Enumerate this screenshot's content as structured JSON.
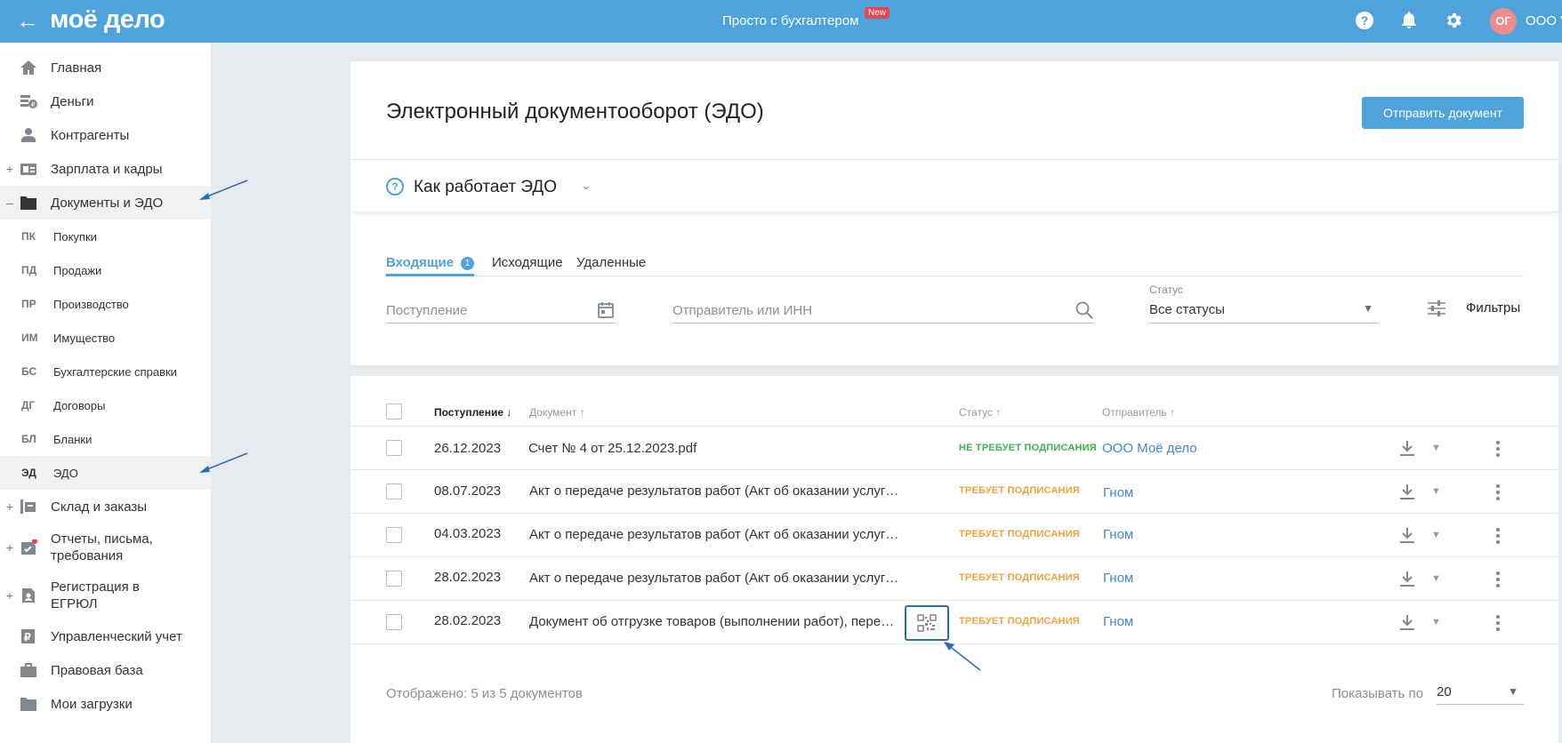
{
  "header": {
    "logo": "моё дело",
    "title": "Просто с бухгалтером",
    "new_badge": "New",
    "avatar_initials": "ОГ",
    "org_name": "ООО \""
  },
  "sidebar": {
    "items": [
      {
        "label": "Главная",
        "icon": "home-icon"
      },
      {
        "label": "Деньги",
        "icon": "money-icon"
      },
      {
        "label": "Контрагенты",
        "icon": "contractors-icon"
      },
      {
        "label": "Зарплата и кадры",
        "icon": "salary-icon",
        "expand": "+"
      },
      {
        "label": "Документы и ЭДО",
        "icon": "folder-icon",
        "expand": "–"
      },
      {
        "label": "Склад и заказы",
        "icon": "warehouse-icon",
        "expand": "+"
      },
      {
        "label": "Отчеты, письма, требования",
        "icon": "reports-icon",
        "expand": "+"
      },
      {
        "label": "Регистрация в ЕГРЮЛ",
        "icon": "registration-icon",
        "expand": "+"
      },
      {
        "label": "Управленческий учет",
        "icon": "ruble-icon"
      },
      {
        "label": "Правовая база",
        "icon": "briefcase-icon"
      },
      {
        "label": "Мои загрузки",
        "icon": "downloads-folder-icon"
      }
    ],
    "subitems": [
      {
        "abbr": "ПК",
        "label": "Покупки"
      },
      {
        "abbr": "ПД",
        "label": "Продажи"
      },
      {
        "abbr": "ПР",
        "label": "Производство"
      },
      {
        "abbr": "ИМ",
        "label": "Имущество"
      },
      {
        "abbr": "БС",
        "label": "Бухгалтерские справки"
      },
      {
        "abbr": "ДГ",
        "label": "Договоры"
      },
      {
        "abbr": "БЛ",
        "label": "Бланки"
      },
      {
        "abbr": "ЭД",
        "label": "ЭДО"
      }
    ]
  },
  "main": {
    "title": "Электронный документооборот (ЭДО)",
    "send_button": "Отправить документ",
    "howto": "Как работает ЭДО",
    "tabs": [
      {
        "label": "Входящие",
        "count": "1"
      },
      {
        "label": "Исходящие"
      },
      {
        "label": "Удаленные"
      }
    ],
    "filters": {
      "date_placeholder": "Поступление",
      "sender_placeholder": "Отправитель или ИНН",
      "status_label": "Статус",
      "status_value": "Все статусы",
      "filters_label": "Фильтры"
    },
    "table": {
      "headers": {
        "date": "Поступление ↓",
        "document": "Документ ↑",
        "status": "Статус ↑",
        "sender": "Отправитель ↑"
      },
      "rows": [
        {
          "date": "26.12.2023",
          "document": "Счет № 4 от 25.12.2023.pdf",
          "status": "НЕ ТРЕБУЕТ ПОДПИСАНИЯ",
          "sender": "ООО Моё дело"
        },
        {
          "date": "08.07.2023",
          "document": "Акт о передаче результатов работ (Акт об оказании услуг…",
          "status": "ТРЕБУЕТ ПОДПИСАНИЯ",
          "sender": "Гном"
        },
        {
          "date": "04.03.2023",
          "document": "Акт о передаче результатов работ (Акт об оказании услуг…",
          "status": "ТРЕБУЕТ ПОДПИСАНИЯ",
          "sender": "Гном"
        },
        {
          "date": "28.02.2023",
          "document": "Акт о передаче результатов работ (Акт об оказании услуг…",
          "status": "ТРЕБУЕТ ПОДПИСАНИЯ",
          "sender": "Гном"
        },
        {
          "date": "28.02.2023",
          "document": "Документ об отгрузке товаров (выполнении работ), пере…",
          "status": "ТРЕБУЕТ ПОДПИСАНИЯ",
          "sender": "Гном"
        }
      ]
    },
    "footer": {
      "shown": "Отображено: 5 из 5 документов",
      "page_size_label": "Показывать по",
      "page_size_value": "20"
    }
  },
  "colors": {
    "brand": "#4ea3dc",
    "status_ok": "#3bb54a",
    "status_warn": "#f0a23b",
    "link": "#3d88cc",
    "annotation": "#2b6cb4"
  }
}
